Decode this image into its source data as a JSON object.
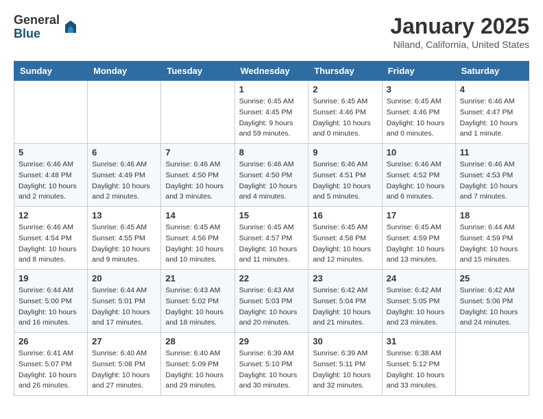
{
  "header": {
    "logo_general": "General",
    "logo_blue": "Blue",
    "month_title": "January 2025",
    "location": "Niland, California, United States"
  },
  "weekdays": [
    "Sunday",
    "Monday",
    "Tuesday",
    "Wednesday",
    "Thursday",
    "Friday",
    "Saturday"
  ],
  "weeks": [
    [
      {
        "day": "",
        "info": ""
      },
      {
        "day": "",
        "info": ""
      },
      {
        "day": "",
        "info": ""
      },
      {
        "day": "1",
        "info": "Sunrise: 6:45 AM\nSunset: 4:45 PM\nDaylight: 9 hours\nand 59 minutes."
      },
      {
        "day": "2",
        "info": "Sunrise: 6:45 AM\nSunset: 4:46 PM\nDaylight: 10 hours\nand 0 minutes."
      },
      {
        "day": "3",
        "info": "Sunrise: 6:45 AM\nSunset: 4:46 PM\nDaylight: 10 hours\nand 0 minutes."
      },
      {
        "day": "4",
        "info": "Sunrise: 6:46 AM\nSunset: 4:47 PM\nDaylight: 10 hours\nand 1 minute."
      }
    ],
    [
      {
        "day": "5",
        "info": "Sunrise: 6:46 AM\nSunset: 4:48 PM\nDaylight: 10 hours\nand 2 minutes."
      },
      {
        "day": "6",
        "info": "Sunrise: 6:46 AM\nSunset: 4:49 PM\nDaylight: 10 hours\nand 2 minutes."
      },
      {
        "day": "7",
        "info": "Sunrise: 6:46 AM\nSunset: 4:50 PM\nDaylight: 10 hours\nand 3 minutes."
      },
      {
        "day": "8",
        "info": "Sunrise: 6:46 AM\nSunset: 4:50 PM\nDaylight: 10 hours\nand 4 minutes."
      },
      {
        "day": "9",
        "info": "Sunrise: 6:46 AM\nSunset: 4:51 PM\nDaylight: 10 hours\nand 5 minutes."
      },
      {
        "day": "10",
        "info": "Sunrise: 6:46 AM\nSunset: 4:52 PM\nDaylight: 10 hours\nand 6 minutes."
      },
      {
        "day": "11",
        "info": "Sunrise: 6:46 AM\nSunset: 4:53 PM\nDaylight: 10 hours\nand 7 minutes."
      }
    ],
    [
      {
        "day": "12",
        "info": "Sunrise: 6:46 AM\nSunset: 4:54 PM\nDaylight: 10 hours\nand 8 minutes."
      },
      {
        "day": "13",
        "info": "Sunrise: 6:45 AM\nSunset: 4:55 PM\nDaylight: 10 hours\nand 9 minutes."
      },
      {
        "day": "14",
        "info": "Sunrise: 6:45 AM\nSunset: 4:56 PM\nDaylight: 10 hours\nand 10 minutes."
      },
      {
        "day": "15",
        "info": "Sunrise: 6:45 AM\nSunset: 4:57 PM\nDaylight: 10 hours\nand 11 minutes."
      },
      {
        "day": "16",
        "info": "Sunrise: 6:45 AM\nSunset: 4:58 PM\nDaylight: 10 hours\nand 12 minutes."
      },
      {
        "day": "17",
        "info": "Sunrise: 6:45 AM\nSunset: 4:59 PM\nDaylight: 10 hours\nand 13 minutes."
      },
      {
        "day": "18",
        "info": "Sunrise: 6:44 AM\nSunset: 4:59 PM\nDaylight: 10 hours\nand 15 minutes."
      }
    ],
    [
      {
        "day": "19",
        "info": "Sunrise: 6:44 AM\nSunset: 5:00 PM\nDaylight: 10 hours\nand 16 minutes."
      },
      {
        "day": "20",
        "info": "Sunrise: 6:44 AM\nSunset: 5:01 PM\nDaylight: 10 hours\nand 17 minutes."
      },
      {
        "day": "21",
        "info": "Sunrise: 6:43 AM\nSunset: 5:02 PM\nDaylight: 10 hours\nand 18 minutes."
      },
      {
        "day": "22",
        "info": "Sunrise: 6:43 AM\nSunset: 5:03 PM\nDaylight: 10 hours\nand 20 minutes."
      },
      {
        "day": "23",
        "info": "Sunrise: 6:42 AM\nSunset: 5:04 PM\nDaylight: 10 hours\nand 21 minutes."
      },
      {
        "day": "24",
        "info": "Sunrise: 6:42 AM\nSunset: 5:05 PM\nDaylight: 10 hours\nand 23 minutes."
      },
      {
        "day": "25",
        "info": "Sunrise: 6:42 AM\nSunset: 5:06 PM\nDaylight: 10 hours\nand 24 minutes."
      }
    ],
    [
      {
        "day": "26",
        "info": "Sunrise: 6:41 AM\nSunset: 5:07 PM\nDaylight: 10 hours\nand 26 minutes."
      },
      {
        "day": "27",
        "info": "Sunrise: 6:40 AM\nSunset: 5:08 PM\nDaylight: 10 hours\nand 27 minutes."
      },
      {
        "day": "28",
        "info": "Sunrise: 6:40 AM\nSunset: 5:09 PM\nDaylight: 10 hours\nand 29 minutes."
      },
      {
        "day": "29",
        "info": "Sunrise: 6:39 AM\nSunset: 5:10 PM\nDaylight: 10 hours\nand 30 minutes."
      },
      {
        "day": "30",
        "info": "Sunrise: 6:39 AM\nSunset: 5:11 PM\nDaylight: 10 hours\nand 32 minutes."
      },
      {
        "day": "31",
        "info": "Sunrise: 6:38 AM\nSunset: 5:12 PM\nDaylight: 10 hours\nand 33 minutes."
      },
      {
        "day": "",
        "info": ""
      }
    ]
  ]
}
